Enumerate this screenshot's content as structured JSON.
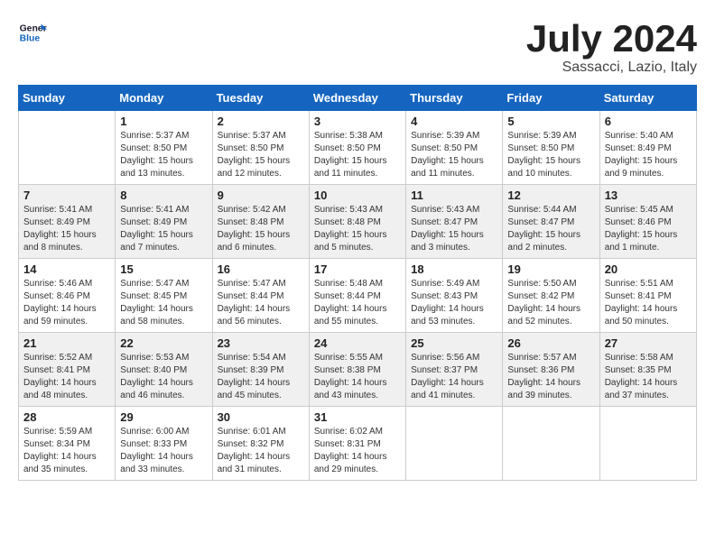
{
  "logo": {
    "name": "General",
    "name2": "Blue"
  },
  "title": "July 2024",
  "subtitle": "Sassacci, Lazio, Italy",
  "days_of_week": [
    "Sunday",
    "Monday",
    "Tuesday",
    "Wednesday",
    "Thursday",
    "Friday",
    "Saturday"
  ],
  "weeks": [
    [
      {
        "day": "",
        "sunrise": "",
        "sunset": "",
        "daylight": ""
      },
      {
        "day": "1",
        "sunrise": "Sunrise: 5:37 AM",
        "sunset": "Sunset: 8:50 PM",
        "daylight": "Daylight: 15 hours and 13 minutes."
      },
      {
        "day": "2",
        "sunrise": "Sunrise: 5:37 AM",
        "sunset": "Sunset: 8:50 PM",
        "daylight": "Daylight: 15 hours and 12 minutes."
      },
      {
        "day": "3",
        "sunrise": "Sunrise: 5:38 AM",
        "sunset": "Sunset: 8:50 PM",
        "daylight": "Daylight: 15 hours and 11 minutes."
      },
      {
        "day": "4",
        "sunrise": "Sunrise: 5:39 AM",
        "sunset": "Sunset: 8:50 PM",
        "daylight": "Daylight: 15 hours and 11 minutes."
      },
      {
        "day": "5",
        "sunrise": "Sunrise: 5:39 AM",
        "sunset": "Sunset: 8:50 PM",
        "daylight": "Daylight: 15 hours and 10 minutes."
      },
      {
        "day": "6",
        "sunrise": "Sunrise: 5:40 AM",
        "sunset": "Sunset: 8:49 PM",
        "daylight": "Daylight: 15 hours and 9 minutes."
      }
    ],
    [
      {
        "day": "7",
        "sunrise": "Sunrise: 5:41 AM",
        "sunset": "Sunset: 8:49 PM",
        "daylight": "Daylight: 15 hours and 8 minutes."
      },
      {
        "day": "8",
        "sunrise": "Sunrise: 5:41 AM",
        "sunset": "Sunset: 8:49 PM",
        "daylight": "Daylight: 15 hours and 7 minutes."
      },
      {
        "day": "9",
        "sunrise": "Sunrise: 5:42 AM",
        "sunset": "Sunset: 8:48 PM",
        "daylight": "Daylight: 15 hours and 6 minutes."
      },
      {
        "day": "10",
        "sunrise": "Sunrise: 5:43 AM",
        "sunset": "Sunset: 8:48 PM",
        "daylight": "Daylight: 15 hours and 5 minutes."
      },
      {
        "day": "11",
        "sunrise": "Sunrise: 5:43 AM",
        "sunset": "Sunset: 8:47 PM",
        "daylight": "Daylight: 15 hours and 3 minutes."
      },
      {
        "day": "12",
        "sunrise": "Sunrise: 5:44 AM",
        "sunset": "Sunset: 8:47 PM",
        "daylight": "Daylight: 15 hours and 2 minutes."
      },
      {
        "day": "13",
        "sunrise": "Sunrise: 5:45 AM",
        "sunset": "Sunset: 8:46 PM",
        "daylight": "Daylight: 15 hours and 1 minute."
      }
    ],
    [
      {
        "day": "14",
        "sunrise": "Sunrise: 5:46 AM",
        "sunset": "Sunset: 8:46 PM",
        "daylight": "Daylight: 14 hours and 59 minutes."
      },
      {
        "day": "15",
        "sunrise": "Sunrise: 5:47 AM",
        "sunset": "Sunset: 8:45 PM",
        "daylight": "Daylight: 14 hours and 58 minutes."
      },
      {
        "day": "16",
        "sunrise": "Sunrise: 5:47 AM",
        "sunset": "Sunset: 8:44 PM",
        "daylight": "Daylight: 14 hours and 56 minutes."
      },
      {
        "day": "17",
        "sunrise": "Sunrise: 5:48 AM",
        "sunset": "Sunset: 8:44 PM",
        "daylight": "Daylight: 14 hours and 55 minutes."
      },
      {
        "day": "18",
        "sunrise": "Sunrise: 5:49 AM",
        "sunset": "Sunset: 8:43 PM",
        "daylight": "Daylight: 14 hours and 53 minutes."
      },
      {
        "day": "19",
        "sunrise": "Sunrise: 5:50 AM",
        "sunset": "Sunset: 8:42 PM",
        "daylight": "Daylight: 14 hours and 52 minutes."
      },
      {
        "day": "20",
        "sunrise": "Sunrise: 5:51 AM",
        "sunset": "Sunset: 8:41 PM",
        "daylight": "Daylight: 14 hours and 50 minutes."
      }
    ],
    [
      {
        "day": "21",
        "sunrise": "Sunrise: 5:52 AM",
        "sunset": "Sunset: 8:41 PM",
        "daylight": "Daylight: 14 hours and 48 minutes."
      },
      {
        "day": "22",
        "sunrise": "Sunrise: 5:53 AM",
        "sunset": "Sunset: 8:40 PM",
        "daylight": "Daylight: 14 hours and 46 minutes."
      },
      {
        "day": "23",
        "sunrise": "Sunrise: 5:54 AM",
        "sunset": "Sunset: 8:39 PM",
        "daylight": "Daylight: 14 hours and 45 minutes."
      },
      {
        "day": "24",
        "sunrise": "Sunrise: 5:55 AM",
        "sunset": "Sunset: 8:38 PM",
        "daylight": "Daylight: 14 hours and 43 minutes."
      },
      {
        "day": "25",
        "sunrise": "Sunrise: 5:56 AM",
        "sunset": "Sunset: 8:37 PM",
        "daylight": "Daylight: 14 hours and 41 minutes."
      },
      {
        "day": "26",
        "sunrise": "Sunrise: 5:57 AM",
        "sunset": "Sunset: 8:36 PM",
        "daylight": "Daylight: 14 hours and 39 minutes."
      },
      {
        "day": "27",
        "sunrise": "Sunrise: 5:58 AM",
        "sunset": "Sunset: 8:35 PM",
        "daylight": "Daylight: 14 hours and 37 minutes."
      }
    ],
    [
      {
        "day": "28",
        "sunrise": "Sunrise: 5:59 AM",
        "sunset": "Sunset: 8:34 PM",
        "daylight": "Daylight: 14 hours and 35 minutes."
      },
      {
        "day": "29",
        "sunrise": "Sunrise: 6:00 AM",
        "sunset": "Sunset: 8:33 PM",
        "daylight": "Daylight: 14 hours and 33 minutes."
      },
      {
        "day": "30",
        "sunrise": "Sunrise: 6:01 AM",
        "sunset": "Sunset: 8:32 PM",
        "daylight": "Daylight: 14 hours and 31 minutes."
      },
      {
        "day": "31",
        "sunrise": "Sunrise: 6:02 AM",
        "sunset": "Sunset: 8:31 PM",
        "daylight": "Daylight: 14 hours and 29 minutes."
      },
      {
        "day": "",
        "sunrise": "",
        "sunset": "",
        "daylight": ""
      },
      {
        "day": "",
        "sunrise": "",
        "sunset": "",
        "daylight": ""
      },
      {
        "day": "",
        "sunrise": "",
        "sunset": "",
        "daylight": ""
      }
    ]
  ]
}
